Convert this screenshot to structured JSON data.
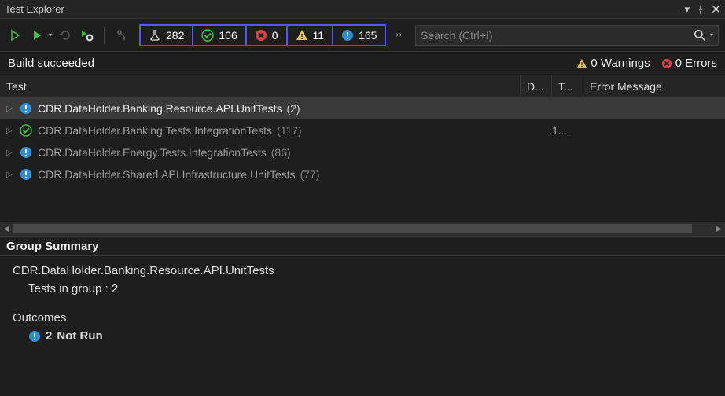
{
  "title": "Test Explorer",
  "toolbar": {
    "summary": {
      "total": "282",
      "passed": "106",
      "failed": "0",
      "warning": "11",
      "notrun": "165"
    },
    "search_placeholder": "Search (Ctrl+I)"
  },
  "build": {
    "status": "Build succeeded",
    "warnings": "0 Warnings",
    "errors": "0 Errors"
  },
  "columns": {
    "test": "Test",
    "d": "D...",
    "t": "T...",
    "err": "Error Message"
  },
  "tree": [
    {
      "icon": "notrun",
      "name": "CDR.DataHolder.Banking.Resource.API.UnitTests",
      "count": "(2)",
      "t": "",
      "selected": true
    },
    {
      "icon": "passed",
      "name": "CDR.DataHolder.Banking.Tests.IntegrationTests",
      "count": "(117)",
      "t": "1....",
      "selected": false
    },
    {
      "icon": "notrun",
      "name": "CDR.DataHolder.Energy.Tests.IntegrationTests",
      "count": "(86)",
      "t": "",
      "selected": false
    },
    {
      "icon": "notrun",
      "name": "CDR.DataHolder.Shared.API.Infrastructure.UnitTests",
      "count": "(77)",
      "t": "",
      "selected": false
    }
  ],
  "summary": {
    "header": "Group Summary",
    "group_name": "CDR.DataHolder.Banking.Resource.API.UnitTests",
    "tests_in_group_label": "Tests in group :",
    "tests_in_group_value": "2",
    "outcomes_label": "Outcomes",
    "outcome_count": "2",
    "outcome_text": "Not  Run"
  }
}
